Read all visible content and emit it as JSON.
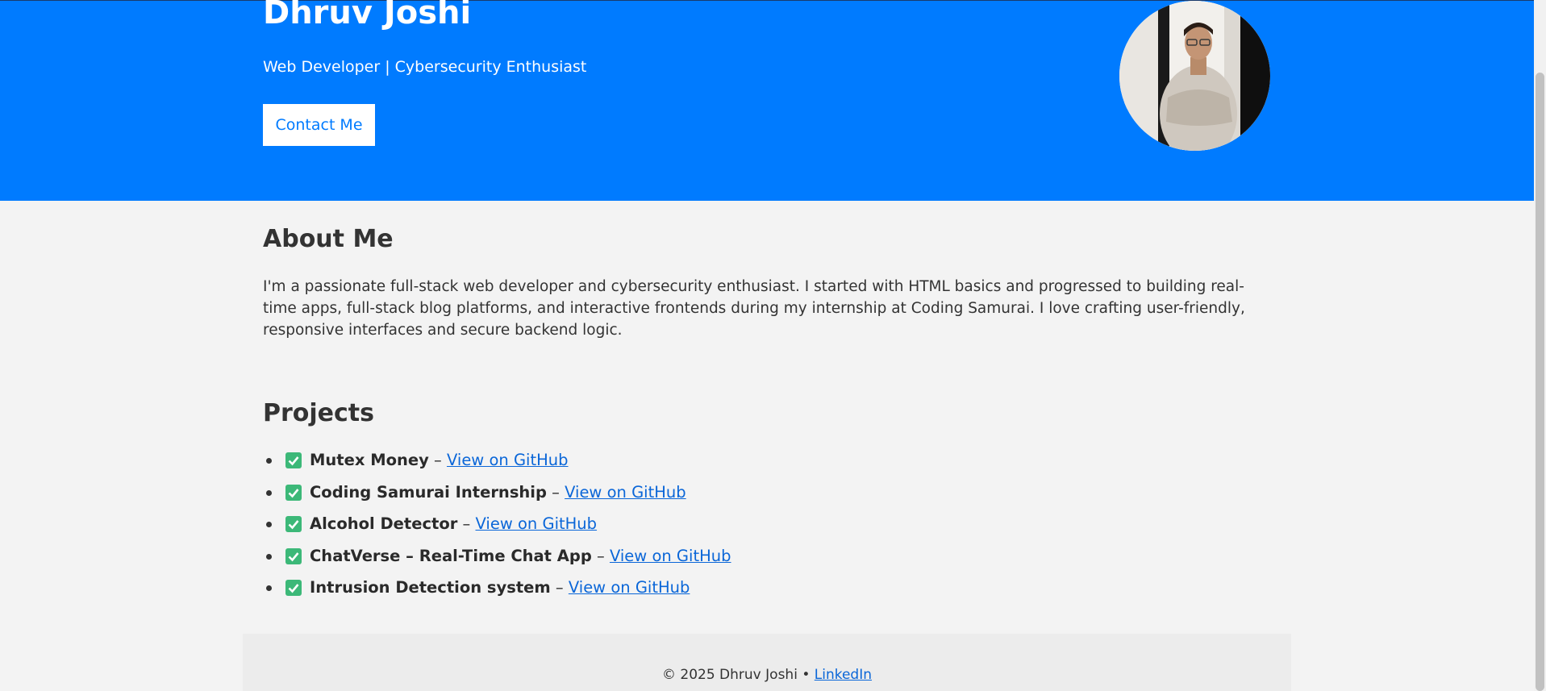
{
  "header": {
    "name": "Dhruv Joshi",
    "tagline": "Web Developer | Cybersecurity Enthusiast",
    "contact_label": "Contact Me",
    "background_color": "#007bff"
  },
  "about": {
    "title": "About Me",
    "text": "I'm a passionate full-stack web developer and cybersecurity enthusiast. I started with HTML basics and progressed to building real-time apps, full-stack blog platforms, and interactive frontends during my internship at Coding Samurai. I love crafting user-friendly, responsive interfaces and secure backend logic."
  },
  "projects": {
    "title": "Projects",
    "items": [
      {
        "name": "Mutex Money",
        "separator": " – ",
        "link_label": "View on GitHub"
      },
      {
        "name": "Coding Samurai Internship",
        "separator": " – ",
        "link_label": "View on GitHub"
      },
      {
        "name": "Alcohol Detector",
        "separator": " – ",
        "link_label": "View on GitHub"
      },
      {
        "name": "ChatVerse – Real-Time Chat App",
        "separator": " – ",
        "link_label": "View on GitHub"
      },
      {
        "name": "Intrusion Detection system",
        "separator": " – ",
        "link_label": "View on GitHub"
      }
    ],
    "check_icon": "check-box-icon",
    "check_color": "#3cb878"
  },
  "footer": {
    "copyright": "© 2025 Dhruv Joshi • ",
    "link_label": "LinkedIn"
  }
}
